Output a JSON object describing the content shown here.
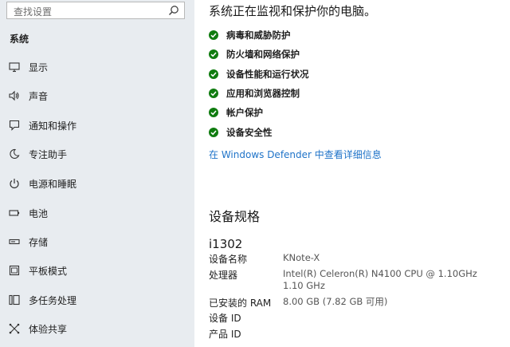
{
  "search": {
    "placeholder": "查找设置"
  },
  "sidebar": {
    "section_title": "系统",
    "items": [
      {
        "label": "显示",
        "icon": "monitor-icon"
      },
      {
        "label": "声音",
        "icon": "speaker-icon"
      },
      {
        "label": "通知和操作",
        "icon": "notification-icon"
      },
      {
        "label": "专注助手",
        "icon": "moon-icon"
      },
      {
        "label": "电源和睡眠",
        "icon": "power-icon"
      },
      {
        "label": "电池",
        "icon": "battery-icon"
      },
      {
        "label": "存储",
        "icon": "storage-icon"
      },
      {
        "label": "平板模式",
        "icon": "tablet-icon"
      },
      {
        "label": "多任务处理",
        "icon": "multitask-icon"
      },
      {
        "label": "体验共享",
        "icon": "share-icon"
      }
    ]
  },
  "security": {
    "title": "系统正在监视和保护你的电脑。",
    "items": [
      "病毒和威胁防护",
      "防火墙和网络保护",
      "设备性能和运行状况",
      "应用和浏览器控制",
      "帐户保护",
      "设备安全性"
    ],
    "link": "在 Windows Defender 中查看详细信息"
  },
  "specs": {
    "heading": "设备规格",
    "device_name": "i1302",
    "rows": [
      {
        "label": "设备名称",
        "value": "KNote-X"
      },
      {
        "label": "处理器",
        "value": "Intel(R) Celeron(R) N4100 CPU @ 1.10GHz   1.10 GHz"
      },
      {
        "label": "已安装的 RAM",
        "value": "8.00 GB (7.82 GB 可用)"
      },
      {
        "label": "设备 ID",
        "value": ""
      },
      {
        "label": "产品 ID",
        "value": ""
      }
    ]
  },
  "colors": {
    "sidebar_bg": "#e8ecf0",
    "check_green": "#107c10",
    "link_blue": "#1f73c8"
  }
}
